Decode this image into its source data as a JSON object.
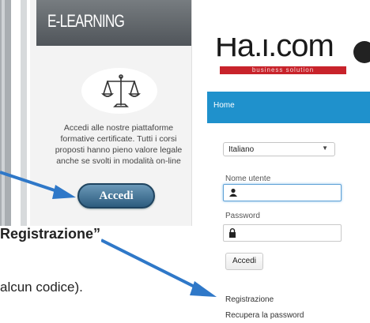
{
  "elearning": {
    "title": "E-LEARNING",
    "description": "Accedi alle nostre piattaforme formative certificate. Tutti i corsi proposti hanno pieno valore legale anche se svolti in modalità on-line",
    "button": "Accedi",
    "icon": "scales-of-justice-icon"
  },
  "instructions": {
    "registrazione_fragment": "Registrazione”",
    "codice_fragment": "alcun codice)."
  },
  "login": {
    "logo_text": "Ha.i.com",
    "logo_tagline": "business solution",
    "nav_home": "Home",
    "language": "Italiano",
    "username_label": "Nome utente",
    "password_label": "Password",
    "login_button": "Accedi",
    "register_link": "Registrazione",
    "recover_link": "Recupera la password"
  },
  "colors": {
    "nav_bar": "#1f91cc",
    "logo_bar": "#c8232b",
    "arrow": "#2f78c8",
    "button": "#2d5c7e"
  }
}
